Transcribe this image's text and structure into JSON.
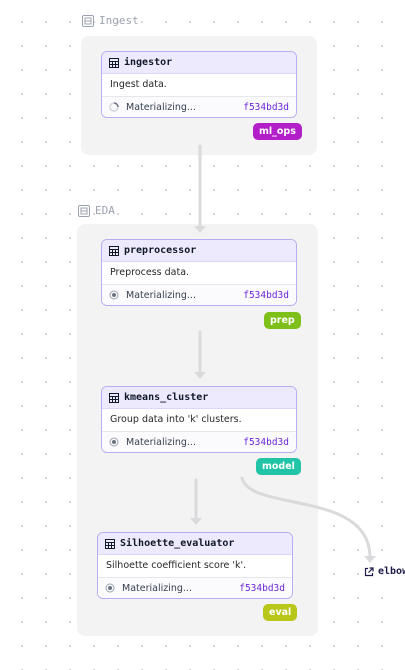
{
  "groups": {
    "ingest": {
      "label": "Ingest"
    },
    "eda": {
      "label": "EDA"
    }
  },
  "assets": {
    "ingestor": {
      "name": "ingestor",
      "description": "Ingest data.",
      "status": "Materializing...",
      "hash": "f534bd3d",
      "status_icon": "spinner-icon",
      "tag": "ml_ops",
      "tag_color": "#b21fc9"
    },
    "preprocessor": {
      "name": "preprocessor",
      "description": "Preprocess data.",
      "status": "Materializing...",
      "hash": "f534bd3d",
      "status_icon": "radio-dot-icon",
      "tag": "prep",
      "tag_color": "#7fbf1a"
    },
    "kmeans_cluster": {
      "name": "kmeans_cluster",
      "description": "Group data into 'k' clusters.",
      "status": "Materializing...",
      "hash": "f534bd3d",
      "status_icon": "radio-dot-icon",
      "tag": "model",
      "tag_color": "#22c4a8"
    },
    "silhouette": {
      "name": "Silhoette_evaluator",
      "description": "Silhoette coefficient score 'k'.",
      "status": "Materializing...",
      "hash": "f534bd3d",
      "status_icon": "radio-dot-icon",
      "tag": "eval",
      "tag_color": "#b9c61a"
    }
  },
  "external_link": {
    "label": "elbow"
  },
  "colors": {
    "node_border": "#b7aef1",
    "node_header": "#edeafd",
    "group_bg": "#f3f3f4",
    "edge": "#dadadd"
  }
}
